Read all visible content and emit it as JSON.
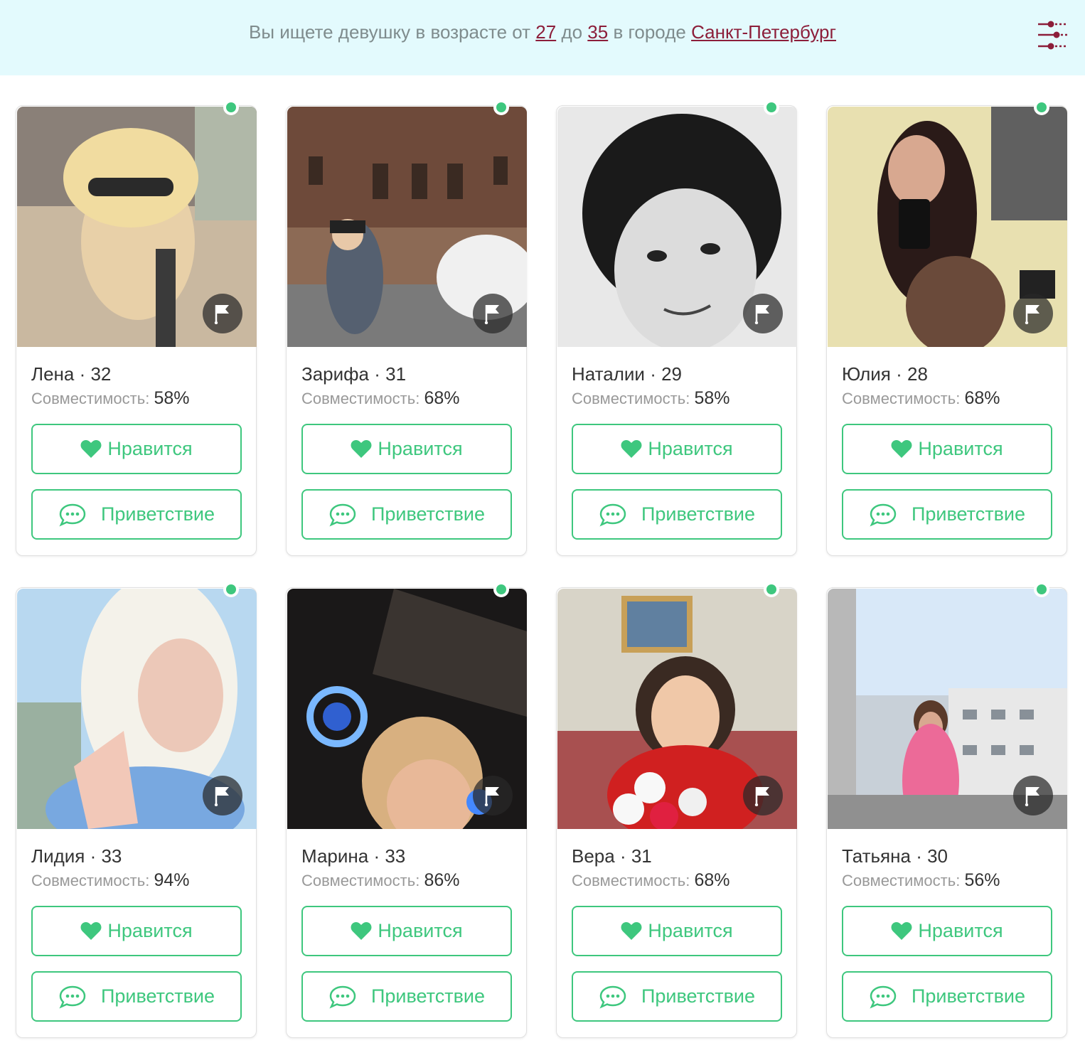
{
  "header": {
    "prefix": "Вы ищете девушку в возрасте от ",
    "age_from": "27",
    "middle": " до ",
    "age_to": "35",
    "city_prefix": " в городе ",
    "city": "Санкт-Петербург",
    "filter_icon": "sliders-icon",
    "accent_color": "#8c1e3a"
  },
  "labels": {
    "compat": "Совместимость:",
    "like": "Нравится",
    "greet": "Приветствие"
  },
  "colors": {
    "accent_green": "#3ec77e",
    "topbar_bg": "#e3fafd"
  },
  "profiles": [
    {
      "name": "Лена",
      "age": "32",
      "compat": "58%",
      "online": true
    },
    {
      "name": "Зарифа",
      "age": "31",
      "compat": "68%",
      "online": true
    },
    {
      "name": "Наталии",
      "age": "29",
      "compat": "58%",
      "online": true
    },
    {
      "name": "Юлия",
      "age": "28",
      "compat": "68%",
      "online": true
    },
    {
      "name": "Лидия",
      "age": "33",
      "compat": "94%",
      "online": true
    },
    {
      "name": "Марина",
      "age": "33",
      "compat": "86%",
      "online": true
    },
    {
      "name": "Вера",
      "age": "31",
      "compat": "68%",
      "online": true
    },
    {
      "name": "Татьяна",
      "age": "30",
      "compat": "56%",
      "online": true
    }
  ]
}
